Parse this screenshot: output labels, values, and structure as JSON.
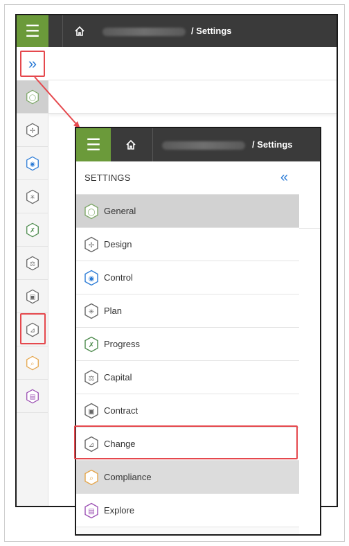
{
  "header": {
    "menu_icon": "hamburger-icon",
    "home_icon": "home-icon",
    "breadcrumb_separator": "/",
    "breadcrumb_current": "Settings"
  },
  "colors": {
    "accent_green": "#6b9a3a",
    "topbar": "#3a3a3a",
    "link_blue": "#2b7bd6",
    "highlight_red": "#e5484d"
  },
  "sidebar": {
    "expand_icon": "double-chevron-right-icon",
    "collapse_icon": "double-chevron-left-icon",
    "title": "SETTINGS",
    "items": [
      {
        "label": "General",
        "icon": "general-icon",
        "color": "#7fa86a",
        "glyph": "◯"
      },
      {
        "label": "Design",
        "icon": "design-icon",
        "color": "#666666",
        "glyph": "✢"
      },
      {
        "label": "Control",
        "icon": "control-icon",
        "color": "#2b7bd6",
        "glyph": "◉"
      },
      {
        "label": "Plan",
        "icon": "plan-icon",
        "color": "#666666",
        "glyph": "✳"
      },
      {
        "label": "Progress",
        "icon": "progress-icon",
        "color": "#4c8a4c",
        "glyph": "✗"
      },
      {
        "label": "Capital",
        "icon": "capital-icon",
        "color": "#666666",
        "glyph": "⚖"
      },
      {
        "label": "Contract",
        "icon": "contract-icon",
        "color": "#666666",
        "glyph": "▣"
      },
      {
        "label": "Change",
        "icon": "change-icon",
        "color": "#666666",
        "glyph": "⊿"
      },
      {
        "label": "Compliance",
        "icon": "compliance-icon",
        "color": "#e5a54a",
        "glyph": "⌕"
      },
      {
        "label": "Explore",
        "icon": "explore-icon",
        "color": "#9b4fb3",
        "glyph": "▤"
      }
    ],
    "active_item": "General",
    "highlighted_item": "Change"
  }
}
